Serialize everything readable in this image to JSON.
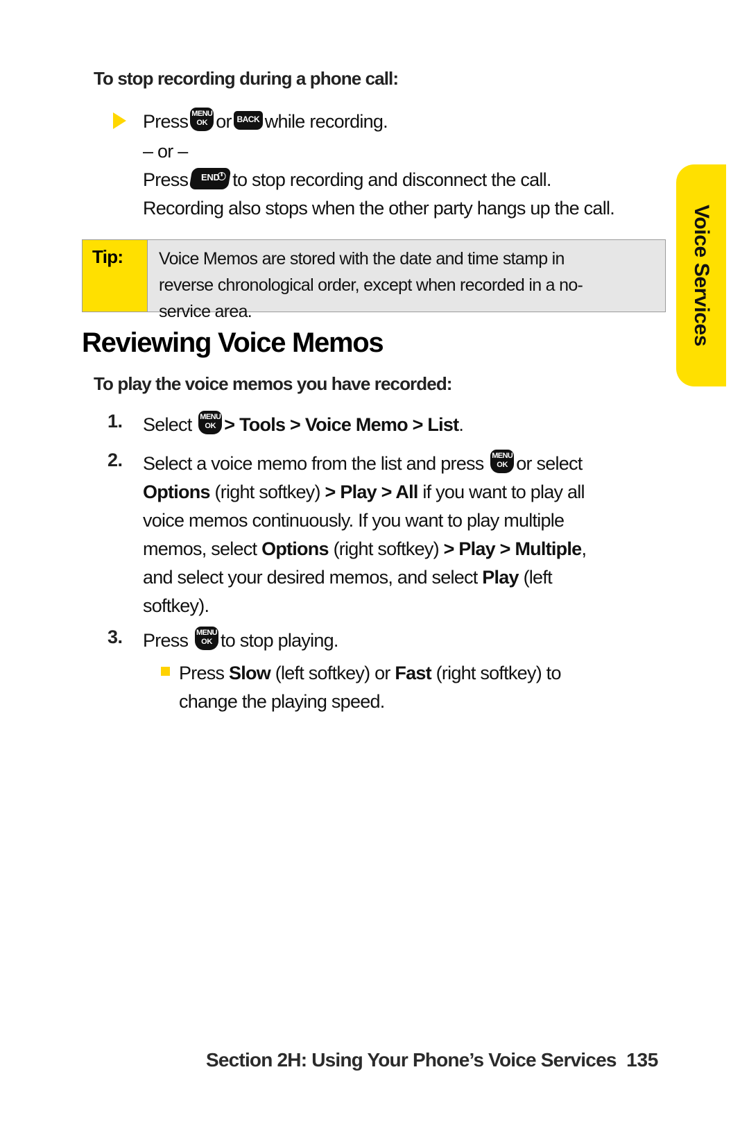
{
  "page": {
    "number": "135",
    "section_footer": "Section 2H: Using Your Phone’s Voice Services"
  },
  "side_tab": {
    "label": "Voice Services",
    "color": "#FFE000"
  },
  "sections": [
    {
      "id": "stop-recording",
      "heading": "To stop recording during a phone call:",
      "bullet": {
        "marker": "triangle-bullet",
        "line1_before_keys": "Press",
        "key1": "menu-ok-key",
        "between_keys": "or",
        "key2": "back-key",
        "line1_after_keys": "while recording.",
        "or_divider": "– or –",
        "line2_before_key": "Press",
        "key3": "end-key",
        "line2_after_key": "to stop recording and disconnect the call.",
        "line3": "Recording also stops when the other party hangs up the call."
      }
    }
  ],
  "tip": {
    "label": "Tip:",
    "text": "Voice Memos are stored with the date and time stamp in reverse chronological order, except when recorded in a no-service area.",
    "lines": [
      "Voice Memos are stored with the date and time stamp in",
      "reverse chronological order, except when recorded in a no-",
      "service area."
    ],
    "label_bg": "#FFE000",
    "body_bg": "#E6E6E6"
  },
  "main_heading": "Reviewing Voice Memos",
  "play_section": {
    "heading": "To play the voice memos you have recorded:",
    "steps": [
      {
        "number": "1.",
        "parts": [
          "Select ",
          "[menu-ok-key]",
          " > ",
          "Tools",
          " > ",
          "Voice Memo",
          " > ",
          "List",
          "."
        ],
        "text_plain": "Select [MENU/OK] > Tools > Voice Memo > List."
      },
      {
        "number": "2.",
        "text_plain": "Select a voice memo from the list and press [MENU/OK] or select Options (right softkey) > Play > All if you want to play all voice memos continuously. If you want to play multiple memos, select Options (right softkey) > Play > Multiple, and select your desired memos, and select Play (left softkey)."
      },
      {
        "number": "3.",
        "text_plain": "Press [MENU/OK] to stop playing.",
        "sub_bullets": [
          {
            "marker": "square-bullet",
            "text_plain": "Press Slow (left softkey) or Fast (right softkey) to change the playing speed."
          }
        ]
      }
    ]
  },
  "keys": {
    "menu_ok": {
      "line1": "MENU",
      "line2": "OK"
    },
    "back": {
      "line1": "BACK"
    },
    "end": {
      "line1": "END",
      "symbol": "power-symbol"
    }
  },
  "step2_lines": [
    "Select a voice memo from the list and press [key] or select",
    "Options (right softkey) > Play > All if you want to play all",
    "voice memos continuously. If you want to play multiple",
    "memos, select Options (right softkey) > Play > Multiple,",
    "and select your desired memos, and select Play (left",
    "softkey)."
  ]
}
